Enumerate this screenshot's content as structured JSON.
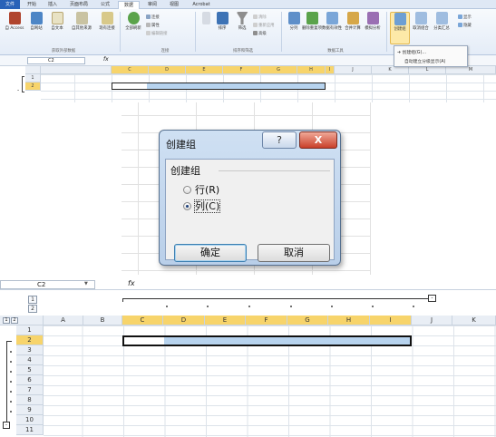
{
  "ribbon": {
    "tabs": [
      "文件",
      "开始",
      "插入",
      "页面布局",
      "公式",
      "数据",
      "审阅",
      "视图",
      "Acrobat"
    ],
    "active_tab": "数据",
    "groups": [
      {
        "name": "获取外部数据",
        "buttons": [
          "自 Access",
          "自网站",
          "自文本",
          "自其他来源",
          "现有连接"
        ]
      },
      {
        "name": "连接",
        "buttons": [
          "全部刷新"
        ],
        "small": [
          "连接",
          "属性",
          "编辑链接"
        ]
      },
      {
        "name": "排序和筛选",
        "buttons": [
          "排序",
          "筛选"
        ],
        "small": [
          "清除",
          "重新应用",
          "高级"
        ]
      },
      {
        "name": "数据工具",
        "buttons": [
          "分列",
          "删除重复项",
          "数据有效性",
          "合并计算",
          "模拟分析"
        ]
      },
      {
        "name": "分级显示",
        "buttons": [
          "创建组",
          "取消组合",
          "分类汇总"
        ],
        "small": [
          "显示",
          "隐藏"
        ]
      }
    ],
    "dropdown_items": [
      "创建组(G)...",
      "自动建立分级显示(A)"
    ]
  },
  "top_sheet": {
    "name_box": "C2",
    "fx": "fx",
    "columns": [
      "C",
      "D",
      "E",
      "F",
      "G",
      "H",
      "I",
      "J",
      "K",
      "L",
      "M"
    ],
    "rows": [
      "1",
      "2"
    ],
    "outline_marker": "-"
  },
  "dialog": {
    "title": "创建组",
    "help_label": "?",
    "close_label": "X",
    "group_label": "创建组",
    "options": [
      {
        "label": "行(R)",
        "selected": false
      },
      {
        "label": "列(C)",
        "selected": true
      }
    ],
    "ok_label": "确定",
    "cancel_label": "取消"
  },
  "bottom_sheet": {
    "name_box": "C2",
    "fx": "fx",
    "outline_levels": [
      "1",
      "2"
    ],
    "collapse_label": "-",
    "columns": [
      "A",
      "B",
      "C",
      "D",
      "E",
      "F",
      "G",
      "H",
      "I",
      "J",
      "K"
    ],
    "selected_columns": [
      "C",
      "D",
      "E",
      "F",
      "G",
      "H",
      "I"
    ],
    "rows": [
      "1",
      "2",
      "3",
      "4",
      "5",
      "6",
      "7",
      "8",
      "9",
      "10",
      "11"
    ],
    "selected_row": "2"
  },
  "colors": {
    "header_bg": "#e9eef5",
    "selected_header": "#f7d46b",
    "selection_fill": "#b7d3ee",
    "dialog_frame": "#b9cfe9",
    "file_tab": "#2a62b8",
    "close_button": "#c9402a"
  }
}
